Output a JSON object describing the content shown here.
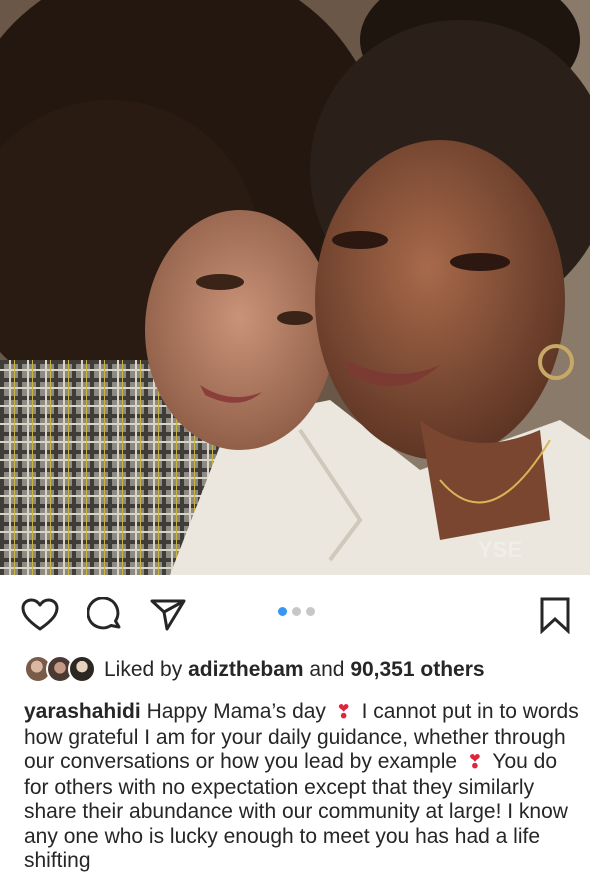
{
  "post": {
    "photo_icon": "photo-image",
    "carousel": {
      "count": 3,
      "active_index": 0
    },
    "necklace_text": "YSE"
  },
  "actions": {
    "like_icon": "heart-outline-icon",
    "comment_icon": "comment-icon",
    "share_icon": "paper-plane-icon",
    "save_icon": "bookmark-icon"
  },
  "likes": {
    "prefix": "Liked by ",
    "user": "adizthebam",
    "middle": " and ",
    "count": "90,351 others"
  },
  "caption": {
    "username": "yarashahidi",
    "text_1": " Happy Mama’s day ",
    "emoji_1": "❣",
    "text_2": " I cannot put in to words how grateful I am for your daily guidance, whether through our conversations or how you lead by example ",
    "emoji_2": "❣",
    "text_3": " You do for others with no expectation except that they similarly share their abundance with our community at large! I know any one who is lucky enough to meet you has had a life shifting"
  },
  "colors": {
    "accent": "#3897f0",
    "text": "#262626",
    "heart_emoji": "#e0243c"
  }
}
